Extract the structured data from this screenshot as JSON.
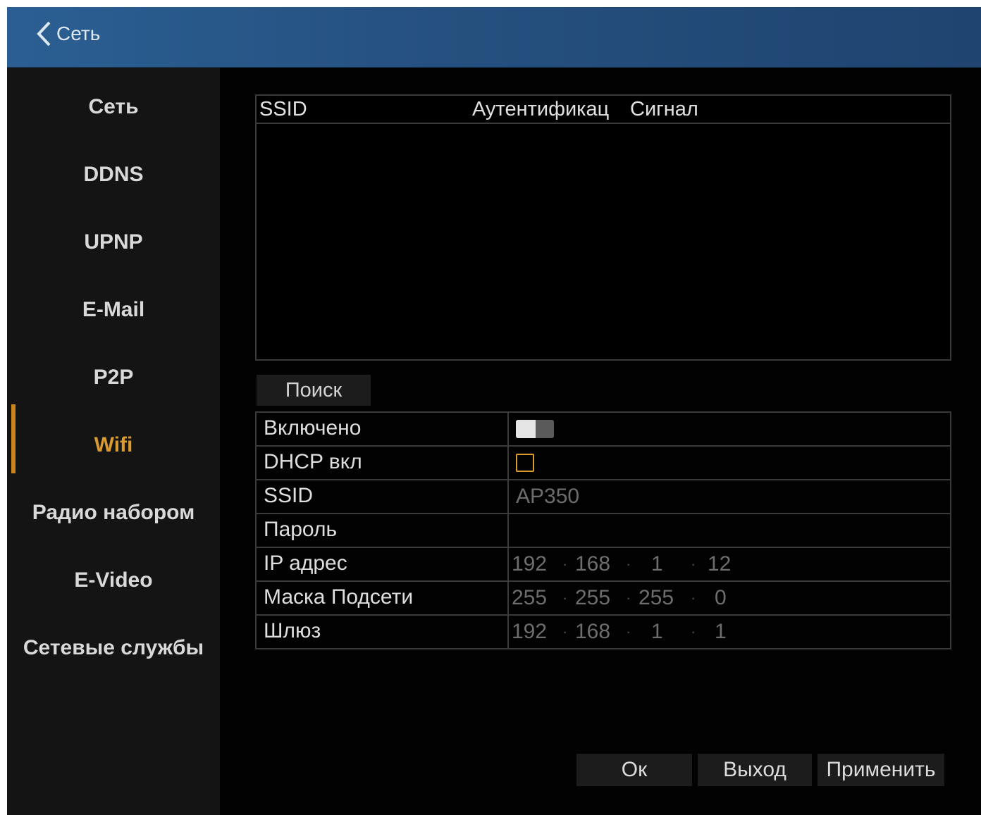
{
  "header": {
    "back_label": "Сеть"
  },
  "sidebar": {
    "items": [
      {
        "label": "Сеть"
      },
      {
        "label": "DDNS"
      },
      {
        "label": "UPNP"
      },
      {
        "label": "E-Mail"
      },
      {
        "label": "P2P"
      },
      {
        "label": "Wifi",
        "active": true
      },
      {
        "label": "Радио набором"
      },
      {
        "label": "E-Video"
      },
      {
        "label": "Сетевые службы"
      }
    ]
  },
  "wifi_list": {
    "columns": [
      "SSID",
      "Аутентификац",
      "Сигнал"
    ],
    "rows": []
  },
  "search_button": "Поиск",
  "form": {
    "enabled": {
      "label": "Включено",
      "value": false
    },
    "dhcp": {
      "label": "DHCP вкл",
      "value": false
    },
    "ssid": {
      "label": "SSID",
      "value": "AP350"
    },
    "password": {
      "label": "Пароль",
      "value": ""
    },
    "ip": {
      "label": "IP адрес",
      "octets": [
        "192",
        "168",
        "1",
        "12"
      ]
    },
    "mask": {
      "label": "Маска Подсети",
      "octets": [
        "255",
        "255",
        "255",
        "0"
      ]
    },
    "gateway": {
      "label": "Шлюз",
      "octets": [
        "192",
        "168",
        "1",
        "1"
      ]
    }
  },
  "buttons": {
    "ok": "Ок",
    "exit": "Выход",
    "apply": "Применить"
  },
  "colors": {
    "accent": "#d99a30",
    "titlebar": "#2b5f93",
    "background": "#020202"
  }
}
